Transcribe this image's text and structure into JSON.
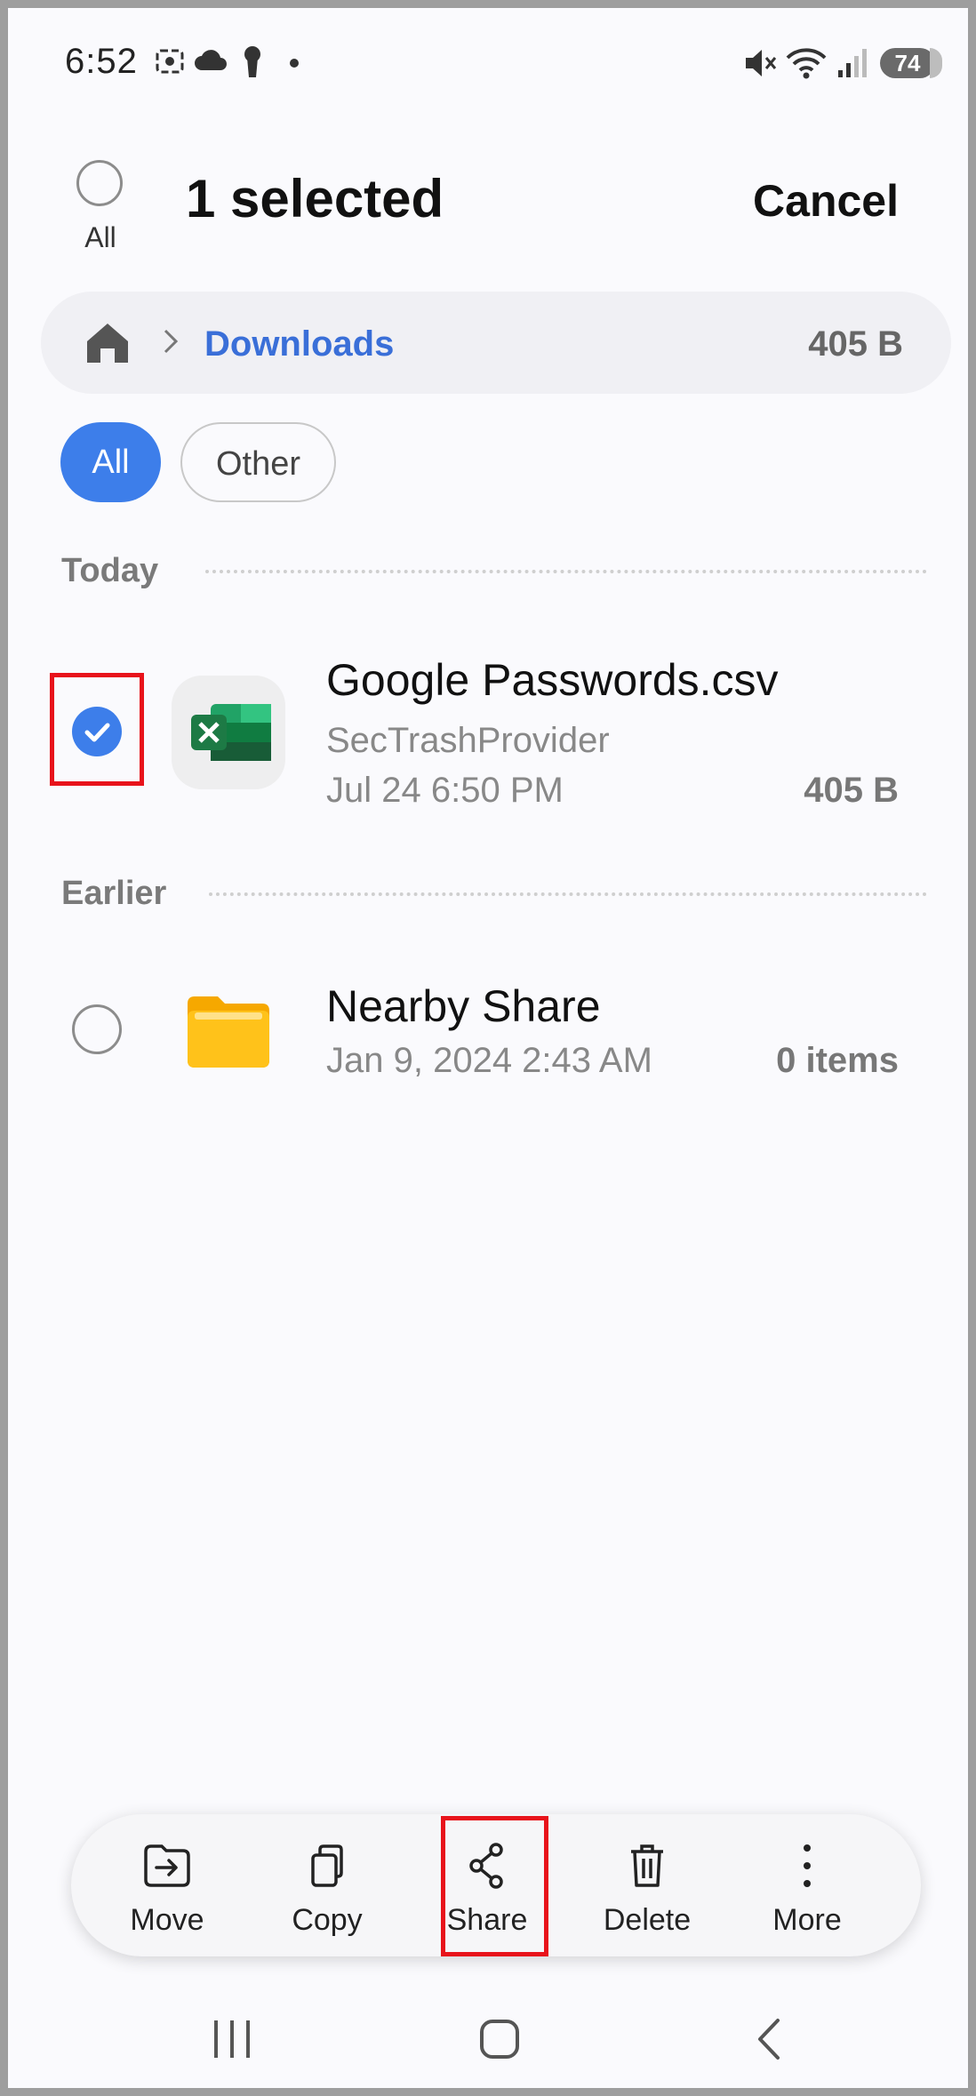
{
  "status_bar": {
    "time": "6:52",
    "battery": "74",
    "icons": [
      "screenshot-icon",
      "cloud-icon",
      "keyhole-icon",
      "dot-icon",
      "mute-icon",
      "wifi-icon",
      "signal-icon",
      "battery-icon"
    ]
  },
  "header": {
    "select_all_label": "All",
    "title": "1 selected",
    "cancel_label": "Cancel"
  },
  "breadcrumb": {
    "home_icon": "home-icon",
    "current": "Downloads",
    "size": "405 B"
  },
  "filters": [
    {
      "label": "All",
      "active": true
    },
    {
      "label": "Other",
      "active": false
    }
  ],
  "sections": [
    {
      "title": "Today",
      "items": [
        {
          "name": "Google Passwords.csv",
          "source": "SecTrashProvider",
          "date": "Jul 24 6:50 PM",
          "size": "405 B",
          "selected": true,
          "icon": "excel-icon"
        }
      ]
    },
    {
      "title": "Earlier",
      "items": [
        {
          "name": "Nearby Share",
          "date": "Jan 9, 2024 2:43 AM",
          "size": "0 items",
          "selected": false,
          "icon": "folder-icon"
        }
      ]
    }
  ],
  "actions": [
    {
      "label": "Move",
      "icon": "move-icon"
    },
    {
      "label": "Copy",
      "icon": "copy-icon"
    },
    {
      "label": "Share",
      "icon": "share-icon"
    },
    {
      "label": "Delete",
      "icon": "delete-icon"
    },
    {
      "label": "More",
      "icon": "more-icon"
    }
  ],
  "nav_bar": [
    "recents-icon",
    "home-button-icon",
    "back-icon"
  ],
  "colors": {
    "accent": "#3d7eea",
    "breadcrumb_link": "#3a6fd8",
    "highlight": "#e8131b",
    "excel_green": "#1d7a45",
    "folder_yellow": "#ffc21a"
  }
}
